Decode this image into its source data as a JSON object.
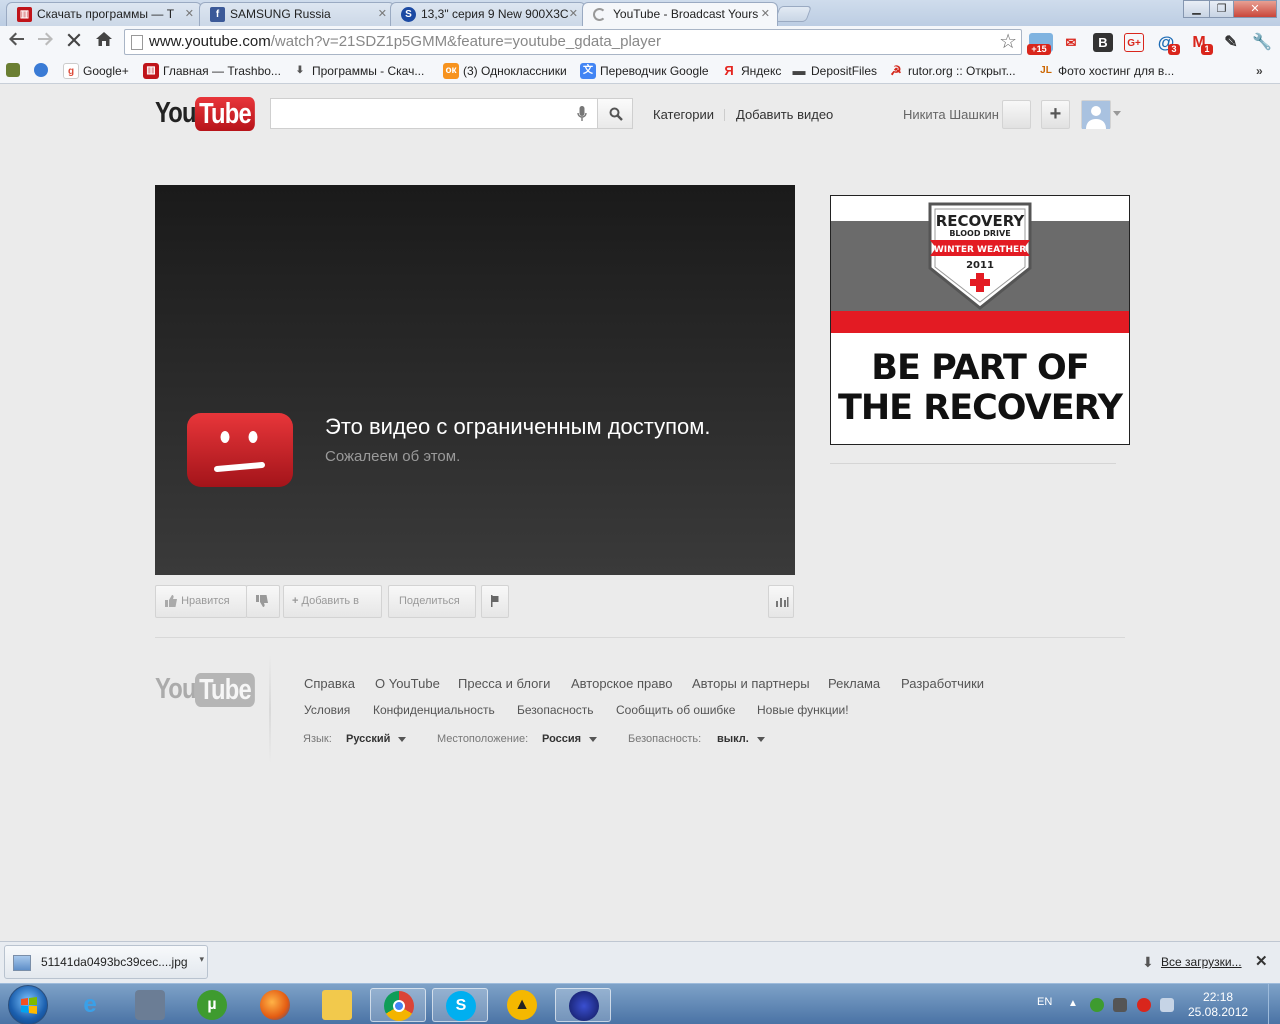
{
  "browser": {
    "tabs": [
      {
        "title": "Скачать программы — Т",
        "icon": "trashbox-icon",
        "color": "#c0141a"
      },
      {
        "title": "SAMSUNG Russia",
        "icon": "facebook-icon",
        "color": "#3b5998"
      },
      {
        "title": "13,3\" серия 9 New 900X3C",
        "icon": "samsung-s-icon",
        "color": "#1c4aa3"
      },
      {
        "title": "YouTube - Broadcast Yours",
        "icon": "loading-spinner-icon",
        "color": "#888888"
      }
    ],
    "url_host": "www.youtube.com",
    "url_path": "/watch?v=21SDZ1p5GMM&feature=youtube_gdata_player",
    "badge_plus15": "+15",
    "badge_mail": "3",
    "badge_gmail": "1",
    "bookmarks": [
      {
        "label": "Google+",
        "icon": "google-icon",
        "color": "#dd4b39"
      },
      {
        "label": "Главная — Trashbo...",
        "icon": "trashbox-icon",
        "color": "#c0141a"
      },
      {
        "label": "Программы - Скач...",
        "icon": "download-icon",
        "color": "#555555"
      },
      {
        "label": "(3) Одноклассники",
        "icon": "odnoklassniki-icon",
        "color": "#f7931e"
      },
      {
        "label": "Переводчик Google",
        "icon": "translate-icon",
        "color": "#4285f4"
      },
      {
        "label": "Яндекс",
        "icon": "yandex-icon",
        "color": "#e52620"
      },
      {
        "label": "DepositFiles",
        "icon": "depositfiles-icon",
        "color": "#444444"
      },
      {
        "label": "rutor.org :: Открыт...",
        "icon": "rutor-icon",
        "color": "#d4291c"
      },
      {
        "label": "Фото хостинг для в...",
        "icon": "photo-hosting-icon",
        "color": "#cc6600"
      }
    ]
  },
  "youtube": {
    "logo_you": "You",
    "logo_tube": "Tube",
    "search_placeholder": "",
    "nav_categories": "Категории",
    "nav_upload": "Добавить видео",
    "user_name": "Никита Шашкин",
    "add_symbol": "+",
    "restricted_title": "Это видео с ограниченным доступом.",
    "restricted_sub": "Сожалеем об этом.",
    "actions": {
      "like": "Нравится",
      "add_to": "Добавить в",
      "share": "Поделиться"
    },
    "ad": {
      "shield_line1": "RECOVERY",
      "shield_line2": "BLOOD DRIVE",
      "shield_ribbon": "WINTER WEATHER",
      "shield_year": "2011",
      "headline_1": "BE PART OF",
      "headline_2": "THE RECOVERY",
      "colors": {
        "red": "#e31b23",
        "grey": "#6b6b6b"
      }
    },
    "footer": {
      "links_row1": [
        "Справка",
        "О YouTube",
        "Пресса и блоги",
        "Авторское право",
        "Авторы и партнеры",
        "Реклама",
        "Разработчики"
      ],
      "links_row2": [
        "Условия",
        "Конфиденциальность",
        "Безопасность",
        "Сообщить об ошибке",
        "Новые функции!"
      ],
      "language_label": "Язык:",
      "language_value": "Русский",
      "location_label": "Местоположение:",
      "location_value": "Россия",
      "safety_label": "Безопасность:",
      "safety_value": "выкл."
    }
  },
  "downloads": {
    "file_name": "51141da0493bc39cec....jpg",
    "all_downloads": "Все загрузки..."
  },
  "taskbar": {
    "lang": "EN",
    "time": "22:18",
    "date": "25.08.2012"
  }
}
